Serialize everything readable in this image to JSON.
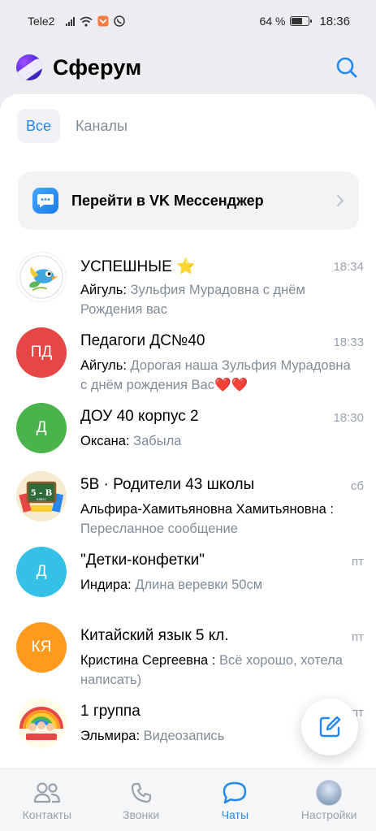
{
  "status_bar": {
    "carrier": "Tele2",
    "battery_percent": "64 %",
    "time": "18:36",
    "battery_level": 0.64
  },
  "app": {
    "title": "Сферум"
  },
  "tabs": [
    {
      "label": "Все",
      "active": true
    },
    {
      "label": "Каналы",
      "active": false
    }
  ],
  "vk_banner": {
    "label": "Перейти в VK Мессенджер"
  },
  "chats": [
    {
      "title": "УСПЕШНЫЕ ⭐",
      "time": "18:34",
      "sender": "Айгуль: ",
      "message": "Зульфия Мурадовна с днём Рождения вас",
      "avatar_type": "logo-bird",
      "avatar_initials": ""
    },
    {
      "title": "Педагоги ДС№40",
      "time": "18:33",
      "sender": "Айгуль: ",
      "message": "Дорогая наша Зульфия Мурадовна с днём рождения Вас❤️❤️",
      "avatar_type": "initials",
      "avatar_initials": "ПД",
      "avatar_color": "#e64646"
    },
    {
      "title": "ДОУ 40 корпус 2",
      "time": "18:30",
      "sender": "Оксана: ",
      "message": "Забыла",
      "avatar_type": "initials",
      "avatar_initials": "Д",
      "avatar_color": "#4bb34b"
    },
    {
      "title": "5В · Родители 43 школы",
      "time": "сб",
      "sender": "Альфира-Хамитьяновна Хамитьяновна : ",
      "message": "Пересланное сообщение",
      "avatar_type": "chalkboard",
      "avatar_initials": ""
    },
    {
      "title": "\"Детки-конфетки\"",
      "time": "пт",
      "sender": "Индира: ",
      "message": "Длина веревки 50см",
      "avatar_type": "initials",
      "avatar_initials": "Д",
      "avatar_color": "#35c1e6"
    },
    {
      "title": "Китайский язык 5 кл.",
      "time": "пт",
      "sender": "Кристина Сергеевна : ",
      "message": "Всё хорошо, хотела написать)",
      "avatar_type": "initials",
      "avatar_initials": "КЯ",
      "avatar_color": "#ff9a1f"
    },
    {
      "title": "1 группа",
      "time": "пт",
      "sender": "Эльмира: ",
      "message": "Видеозапись",
      "avatar_type": "rainbow",
      "avatar_initials": ""
    }
  ],
  "nav": [
    {
      "label": "Контакты",
      "icon": "contacts-icon",
      "active": false
    },
    {
      "label": "Звонки",
      "icon": "phone-icon",
      "active": false
    },
    {
      "label": "Чаты",
      "icon": "chat-icon",
      "active": true
    },
    {
      "label": "Настройки",
      "icon": "profile-avatar",
      "active": false
    }
  ],
  "colors": {
    "accent": "#2688eb",
    "secondary_text": "#818c99",
    "background": "#ebedf0"
  }
}
